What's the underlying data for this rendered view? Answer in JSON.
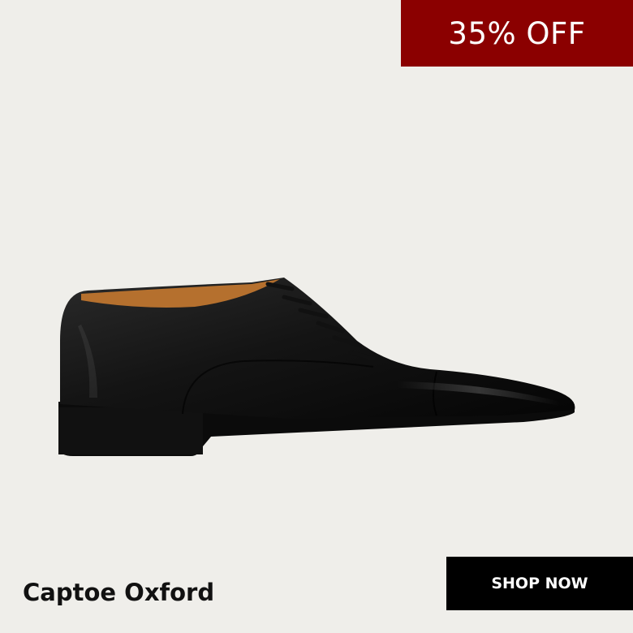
{
  "promo": {
    "discount_label": "35% OFF",
    "accent_color": "#8b0000"
  },
  "product": {
    "name": "Captoe Oxford",
    "image_icon": "captoe-oxford-shoe-image"
  },
  "cta": {
    "label": "SHOP NOW"
  },
  "colors": {
    "background": "#efeeea",
    "button": "#000000",
    "button_text": "#ffffff"
  }
}
